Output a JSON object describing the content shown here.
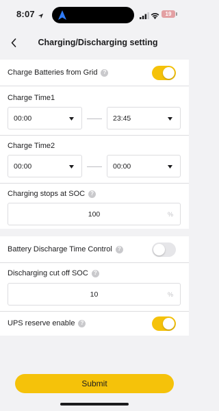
{
  "status_bar": {
    "time": "8:07",
    "battery_level": "19",
    "icons": [
      "location-arrow-icon",
      "navigation-arrow-icon",
      "signal-icon",
      "wifi-icon",
      "battery-icon"
    ]
  },
  "header": {
    "title": "Charging/Discharging setting",
    "back_icon": "chevron-left-icon"
  },
  "colors": {
    "accent": "#f5c20a",
    "background": "#f2f2f4",
    "card": "#ffffff",
    "divider": "#dcdcdf",
    "toggle_off": "#e6e6e9"
  },
  "settings": {
    "charge_from_grid": {
      "label": "Charge Batteries from Grid",
      "help": "?",
      "enabled": true
    },
    "charge_time1": {
      "label": "Charge Time1",
      "start": "00:00",
      "end": "23:45"
    },
    "charge_time2": {
      "label": "Charge Time2",
      "start": "00:00",
      "end": "00:00"
    },
    "charging_stop_soc": {
      "label": "Charging stops at SOC",
      "help": "?",
      "value": "100",
      "unit": "%"
    },
    "discharge_time_control": {
      "label": "Battery Discharge Time Control",
      "help": "?",
      "enabled": false
    },
    "discharge_cutoff_soc": {
      "label": "Discharging cut off SOC",
      "help": "?",
      "value": "10",
      "unit": "%"
    },
    "ups_reserve": {
      "label": "UPS reserve enable",
      "help": "?",
      "enabled": true
    }
  },
  "submit_label": "Submit"
}
